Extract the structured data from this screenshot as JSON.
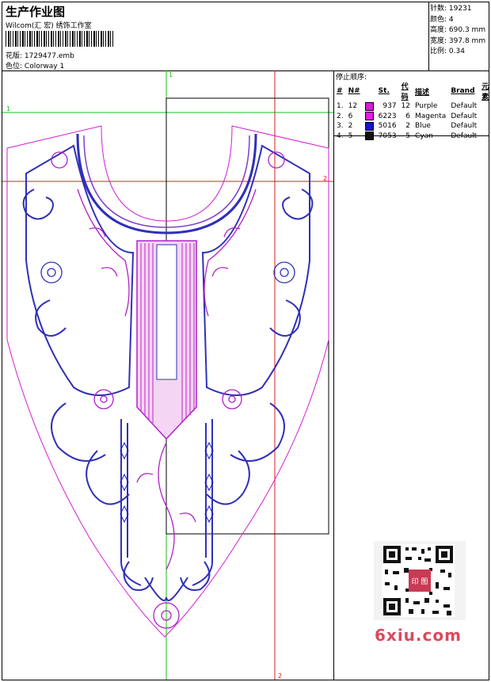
{
  "header": {
    "title": "生产作业图",
    "company": "Wilcom(汇 宏) 绣饰工作室",
    "file_label": "花版:",
    "file_value": "1729477.emb",
    "colorway_label": "色位:",
    "colorway_value": "Colorway 1"
  },
  "specs": [
    {
      "label": "针数:",
      "value": "19231"
    },
    {
      "label": "颜色:",
      "value": "4"
    },
    {
      "label": "高度:",
      "value": "690.3 mm"
    },
    {
      "label": "宽度:",
      "value": "397.8 mm"
    },
    {
      "label": "比例:",
      "value": "0.34"
    }
  ],
  "stop_sequence": {
    "title": "停止顺序:",
    "columns": [
      "#",
      "N#",
      "St.",
      "代码",
      "描述",
      "Brand",
      "元素"
    ],
    "rows": [
      {
        "index": "1.",
        "needle": "12",
        "color": "#d21fd2",
        "stitches": "937",
        "code": "12",
        "desc": "Purple",
        "brand": "Default",
        "element": ""
      },
      {
        "index": "2.",
        "needle": "6",
        "color": "#e61be6",
        "stitches": "6223",
        "code": "6",
        "desc": "Magenta",
        "brand": "Default",
        "element": ""
      },
      {
        "index": "3.",
        "needle": "2",
        "color": "#1414d2",
        "stitches": "5016",
        "code": "2",
        "desc": "Blue",
        "brand": "Default",
        "element": ""
      },
      {
        "index": "4.",
        "needle": "5",
        "color": "#111111",
        "stitches": "7053",
        "code": "5",
        "desc": "Cyan",
        "brand": "Default",
        "element": ""
      }
    ]
  },
  "guides": {
    "marker_1": "1",
    "marker_2": "2"
  },
  "watermark": "6xiu.com",
  "qr_badge": "印 图"
}
